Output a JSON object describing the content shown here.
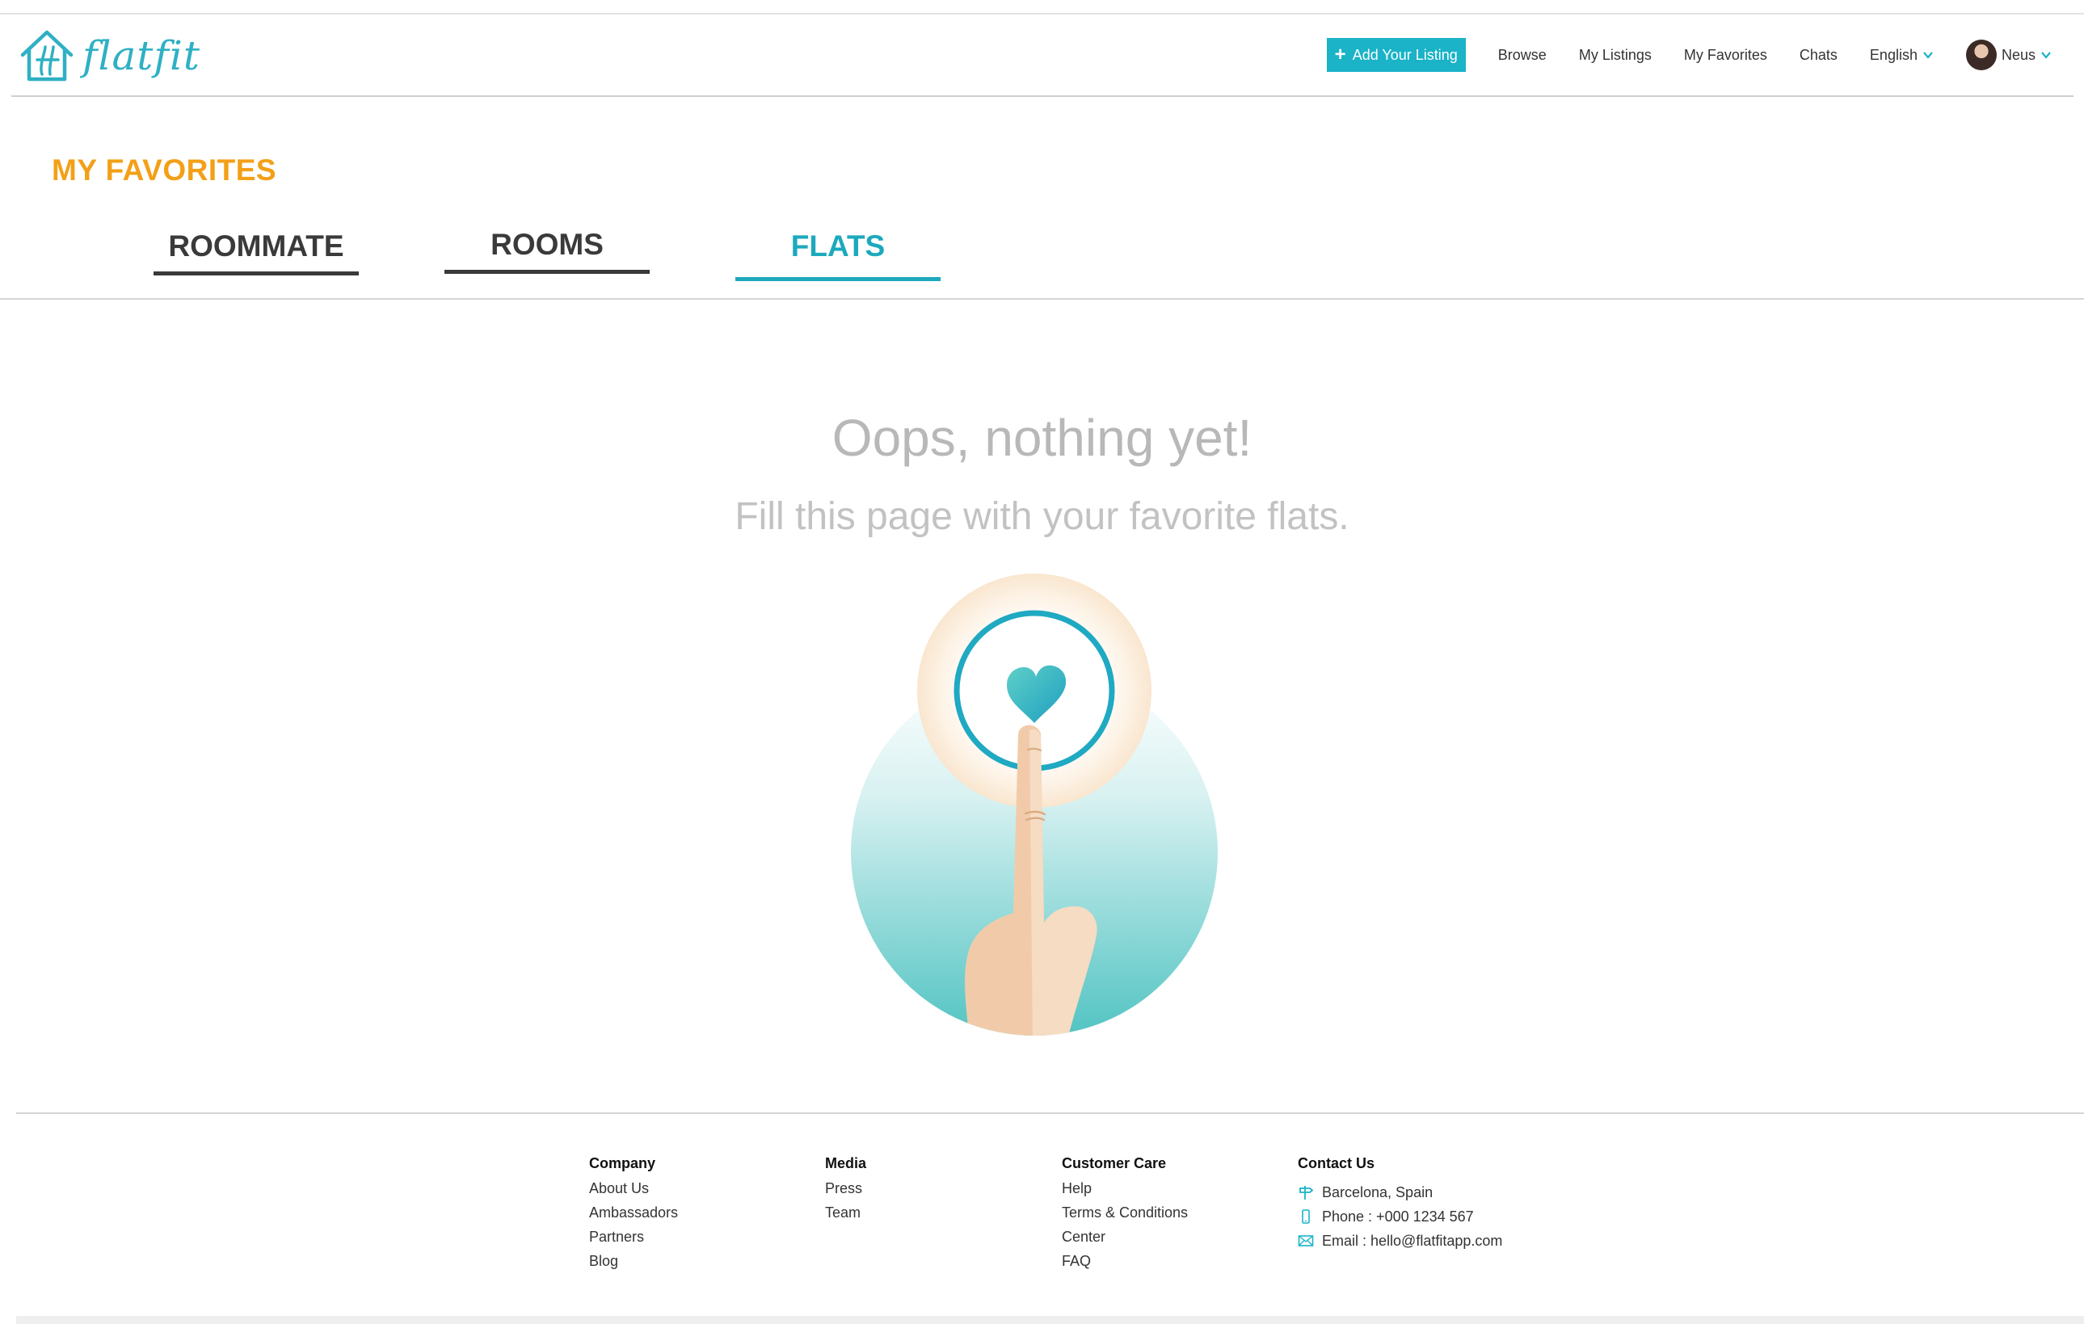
{
  "app": {
    "logo_text": "flatfit"
  },
  "nav": {
    "add_listing": "Add Your Listing",
    "browse": "Browse",
    "my_listings": "My Listings",
    "my_favorites": "My Favorites",
    "chats": "Chats",
    "language": "English",
    "user_name": "Neus"
  },
  "page": {
    "title": "MY FAVORITES",
    "tabs": [
      {
        "label": "ROOMMATE",
        "active": false
      },
      {
        "label": "ROOMS",
        "active": false
      },
      {
        "label": "FLATS",
        "active": true
      }
    ]
  },
  "empty_state": {
    "title": "Oops, nothing yet!",
    "subtitle": "Fill this page with your favorite flats."
  },
  "footer": {
    "company": {
      "heading": "Company",
      "links": [
        "About Us",
        "Ambassadors",
        "Partners",
        "Blog"
      ]
    },
    "media": {
      "heading": "Media",
      "links": [
        "Press",
        "Team"
      ]
    },
    "customer_care": {
      "heading": "Customer Care",
      "links": [
        "Help",
        "Terms & Conditions",
        "Center",
        "FAQ"
      ]
    },
    "contact": {
      "heading": "Contact Us",
      "location": "Barcelona, Spain",
      "phone": "Phone : +000 1234 567",
      "email": "Email : hello@flatfitapp.com"
    }
  },
  "colors": {
    "accent": "#1ab3c8",
    "title_orange": "#f3a018"
  },
  "icons": [
    "house-logo-icon",
    "plus-icon",
    "chevron-down-icon",
    "signpost-icon",
    "phone-icon",
    "mail-icon",
    "heart-icon"
  ]
}
